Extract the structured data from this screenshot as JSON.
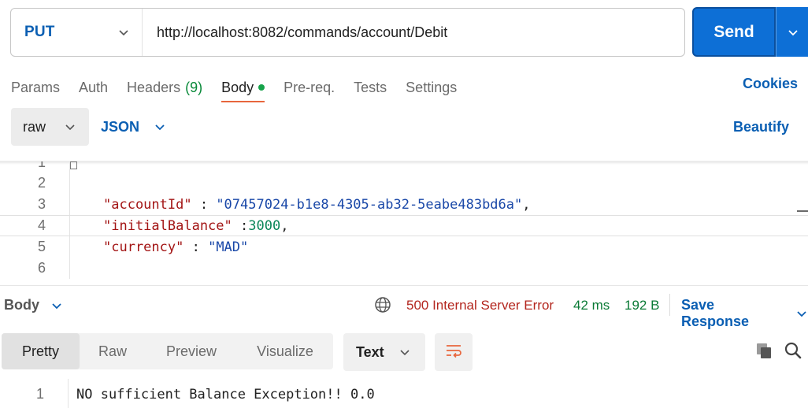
{
  "request": {
    "method": "PUT",
    "url": "http://localhost:8082/commands/account/Debit",
    "send_label": "Send"
  },
  "tabs": [
    {
      "label": "Params"
    },
    {
      "label": "Auth"
    },
    {
      "label": "Headers",
      "count": "(9)"
    },
    {
      "label": "Body"
    },
    {
      "label": "Pre-req."
    },
    {
      "label": "Tests"
    },
    {
      "label": "Settings"
    }
  ],
  "cookies_label": "Cookies",
  "body_toolbar": {
    "mode": "raw",
    "format": "JSON",
    "beautify_label": "Beautify"
  },
  "editor": {
    "line_numbers": [
      "1",
      "2",
      "3",
      "4",
      "5",
      "6"
    ],
    "lines": [
      {
        "key": "\"accountId\"",
        "sep": " : ",
        "value": "\"07457024-b1e8-4305-ab32-5eabe483bd6a\"",
        "tail": ","
      },
      {
        "key": "\"initialBalance\"",
        "sep": " :",
        "value": "3000",
        "tail": ","
      },
      {
        "key": "\"currency\"",
        "sep": " : ",
        "value": "\"MAD\"",
        "tail": ""
      }
    ]
  },
  "response": {
    "body_label": "Body",
    "status": "500 Internal Server Error",
    "time": "42 ms",
    "size": "192 B",
    "save_label": "Save Response",
    "view_tabs": [
      "Pretty",
      "Raw",
      "Preview",
      "Visualize"
    ],
    "active_view": "Pretty",
    "text_format": "Text",
    "line_number": "1",
    "body_text": "NO sufficient Balance Exception!! 0.0"
  },
  "colors": {
    "accent_blue": "#0b5fb3",
    "send_blue": "#0d6fd6",
    "active_underline": "#e8663d",
    "error_red": "#b3261e",
    "success_green": "#0a7a35"
  }
}
